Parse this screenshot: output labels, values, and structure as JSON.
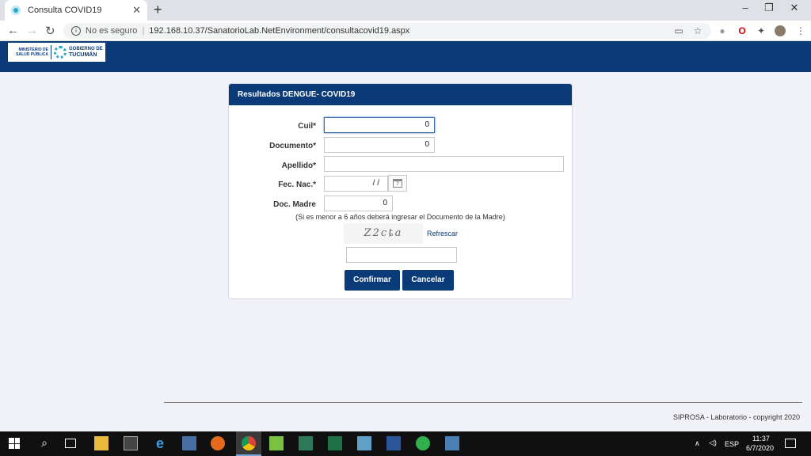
{
  "browser": {
    "tab_title": "Consulta COVID19",
    "security_label": "No es seguro",
    "url": "192.168.10.37/SanatorioLab.NetEnvironment/consultacovid19.aspx"
  },
  "header": {
    "logo_ministry": "MINISTERIO DE SALUD PÚBLICA",
    "logo_gov_line1": "GOBIERNO DE",
    "logo_gov_line2": "TUCUMÁN"
  },
  "form": {
    "title": "Resultados DENGUE- COVID19",
    "fields": {
      "cuil": {
        "label": "Cuil*",
        "value": "0"
      },
      "documento": {
        "label": "Documento*",
        "value": "0"
      },
      "apellido": {
        "label": "Apellido*",
        "value": ""
      },
      "fecnac": {
        "label": "Fec. Nac.*",
        "value": "/ /"
      },
      "docmadre": {
        "label": "Doc. Madre",
        "value": "0"
      }
    },
    "note": "(Si es menor a 6 años deberá ingresar el Documento de la Madre)",
    "captcha_text": "Z2cȶa",
    "refresh_label": "Refrescar",
    "captcha_input": "",
    "confirm_label": "Confirmar",
    "cancel_label": "Cancelar"
  },
  "footer": {
    "text": "SIPROSA - Laboratorio - copyright 2020"
  },
  "taskbar": {
    "lang": "ESP",
    "time": "11:37",
    "date": "6/7/2020"
  },
  "colors": {
    "brand": "#0a3a78",
    "page_bg": "#f1f1f8"
  }
}
